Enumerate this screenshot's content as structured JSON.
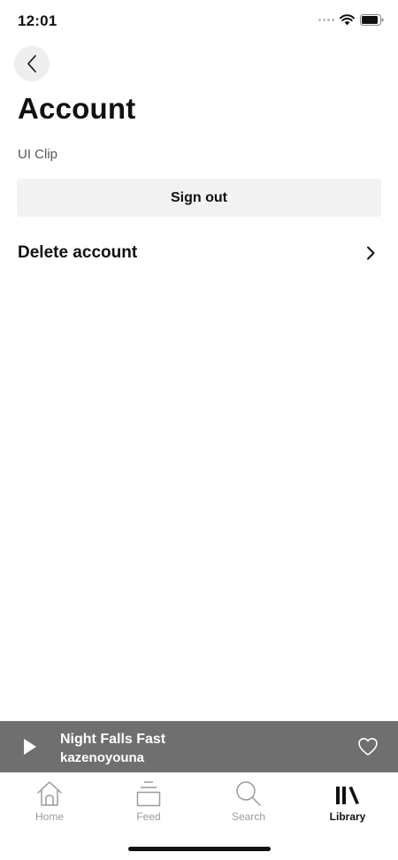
{
  "status_bar": {
    "time": "12:01"
  },
  "header": {
    "title": "Account"
  },
  "account": {
    "name": "UI Clip"
  },
  "actions": {
    "sign_out_label": "Sign out",
    "delete_account_label": "Delete account"
  },
  "mini_player": {
    "track_title": "Night Falls Fast",
    "artist": "kazenoyouna"
  },
  "tab_bar": {
    "items": [
      {
        "label": "Home",
        "icon": "home-icon"
      },
      {
        "label": "Feed",
        "icon": "feed-icon"
      },
      {
        "label": "Search",
        "icon": "search-icon"
      },
      {
        "label": "Library",
        "icon": "library-icon"
      }
    ],
    "active": "Library"
  },
  "colors": {
    "mini_player_bg": "#6f6f6f",
    "button_bg": "#f2f2f2",
    "inactive_tab": "#9a9a9a"
  }
}
